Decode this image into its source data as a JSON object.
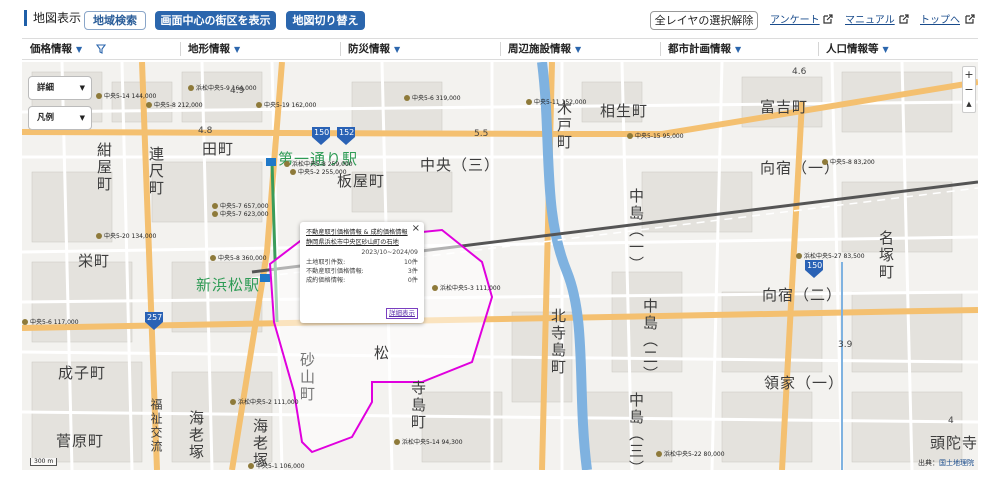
{
  "header": {
    "title": "地図表示",
    "area_search": "地域検索",
    "show_center_block": "画面中心の街区を表示",
    "switch_map": "地図切り替え",
    "clear_all_layers": "全レイヤの選択解除",
    "links": [
      {
        "label": "アンケート"
      },
      {
        "label": "マニュアル"
      },
      {
        "label": "トップへ"
      }
    ]
  },
  "categories": [
    {
      "label": "価格情報"
    },
    {
      "label": "地形情報"
    },
    {
      "label": "防災情報"
    },
    {
      "label": "周辺施設情報"
    },
    {
      "label": "都市計画情報"
    },
    {
      "label": "人口情報等"
    }
  ],
  "map_controls": {
    "detail": "詳細",
    "legend": "凡例",
    "zoom_in": "+",
    "zoom_out": "−",
    "compass": "▲"
  },
  "popup": {
    "link1": "不動産取引価格情報 & 成約価格情報",
    "link2": "静岡県浜松市中央区砂山町の石地",
    "period": "2023/10~2024/09",
    "rows": [
      {
        "label": "土地取引件数:",
        "value": "10件"
      },
      {
        "label": "不動産取引価格情報:",
        "value": "3件"
      },
      {
        "label": "成約価格情報:",
        "value": "0件"
      }
    ],
    "detail_button": "詳細表示",
    "close": "×"
  },
  "map_labels": {
    "town_aioi": "相生町",
    "town_tomiyoshi": "富吉町",
    "town_muko": "向宿（一）",
    "town_muko2": "向宿（二）",
    "town_itabashi": "板屋町",
    "town_chuo": "中央（三）",
    "town_ryoke": "領家（一）",
    "town_nakajima1": "中島（一）",
    "town_nakajima2": "中島（二）",
    "town_nakajima3": "中島（三）",
    "town_kitadera": "北寺島町",
    "town_tera": "寺島町",
    "town_ebizuka": "海老塚",
    "town_sunayama": "砂山町",
    "town_nagatsuka": "名塚町",
    "town_kisoe": "成子町",
    "town_sugahara": "菅原町",
    "town_tamachi": "田町",
    "town_konya": "紺屋町",
    "town_renjaku": "連尺町",
    "town_sakae": "栄町",
    "town_kido": "木戸町",
    "town_matsu": "松",
    "town_zudatsu": "頭陀寺",
    "station_daiichi": "第一通り駅",
    "station_shinhamamatsu": "新浜松駅",
    "route_150a": "150",
    "route_152": "152",
    "route_150b": "150",
    "route_257": "257",
    "fukushi": "福祉交流",
    "ebizuka2": "海老塚"
  },
  "price_labels": [
    "中央5-14 144,000",
    "浜松中央5-9 164,000",
    "中央5-8 212,000",
    "中央5-19 162,000",
    "中央5-6 319,000",
    "中央5-11 152,000",
    "中央5-15 95,000",
    "中央5-8 83,200",
    "浜松中央5-8 259,000",
    "中央5-2 255,000",
    "中央5-7 657,000",
    "中央5-7 623,000",
    "中央5-20 134,000",
    "中央5-8 360,000",
    "中央5-6 117,000",
    "浜松中央5-3 111,000",
    "浜松中央5-27 83,500",
    "浜松中央5-2 111,000",
    "浜松中央5-14 94,300",
    "浜松中央5-22 80,000",
    "中央5-1 106,000",
    "浜松中央5-13 181,000"
  ],
  "triangulation": [
    "4.6",
    "4.9",
    "4.8",
    "5.5",
    "3.9",
    "4"
  ],
  "scale": "300 m",
  "attribution": {
    "prefix": "出典：",
    "source": "国土地理院"
  },
  "colors": {
    "accent": "#2b66ad",
    "boundary": "#e800e0",
    "rail": "#555555",
    "river": "#6fa8dc",
    "major_road": "#f6c87a"
  }
}
